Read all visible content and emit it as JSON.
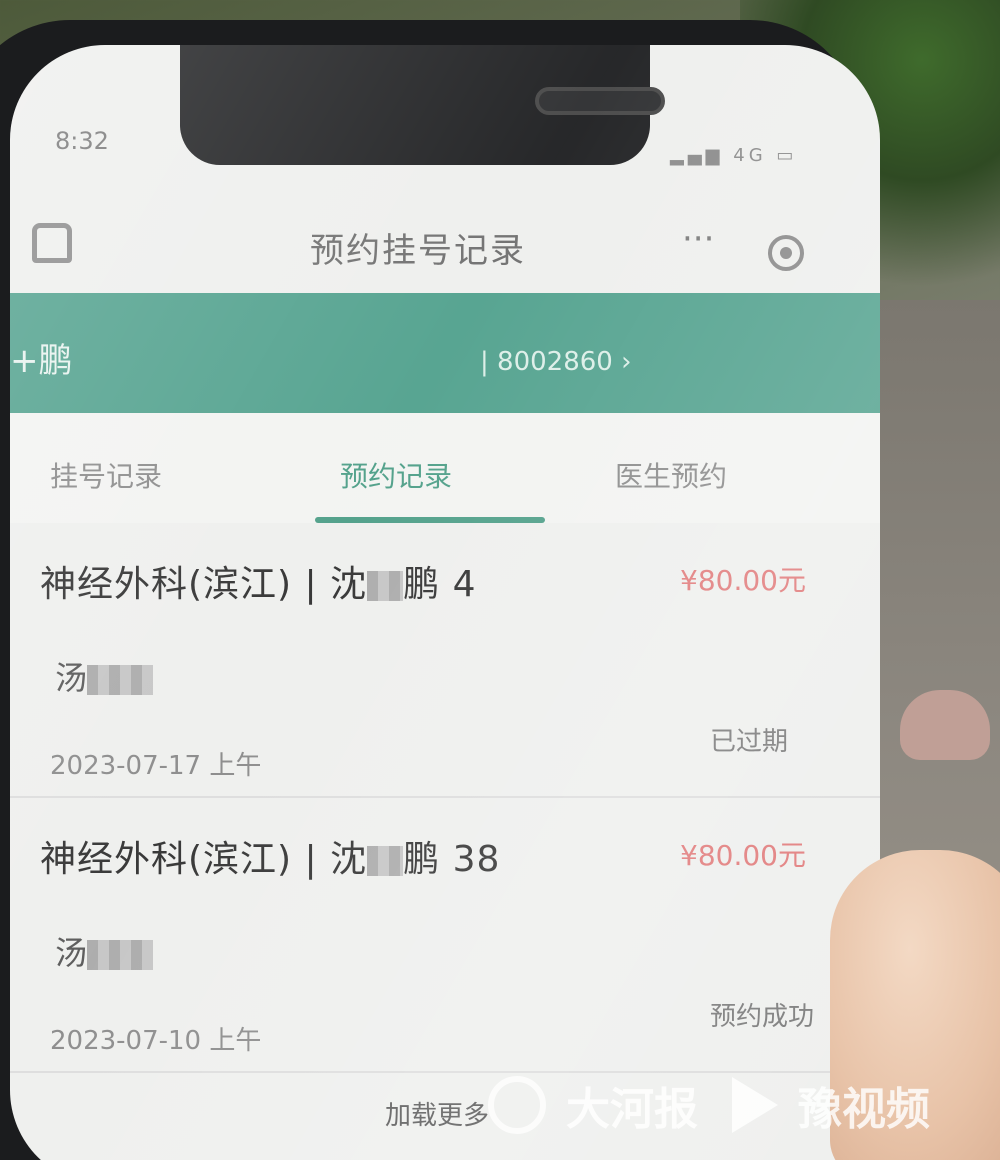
{
  "status_bar": {
    "time": "8:32",
    "network": "4G"
  },
  "nav": {
    "title": "预约挂号记录",
    "more_icon": "ellipsis-icon",
    "close_icon": "target-close-icon",
    "home_icon": "home-icon"
  },
  "patient": {
    "name": "+鹏",
    "card_number": "8002860"
  },
  "tabs": [
    {
      "label": "挂号记录",
      "active": false
    },
    {
      "label": "预约记录",
      "active": true
    },
    {
      "label": "医生预约",
      "active": false
    }
  ],
  "records": [
    {
      "department": "神经外科(滨江)",
      "doctor_prefix": "沈",
      "doctor_suffix": "鹏",
      "number": "4",
      "fee": "¥80.00元",
      "patient_prefix": "汤",
      "date": "2023-07-17 上午",
      "status": "已过期"
    },
    {
      "department": "神经外科(滨江)",
      "doctor_prefix": "沈",
      "doctor_suffix": "鹏",
      "number": "38",
      "fee": "¥80.00元",
      "patient_prefix": "汤",
      "date": "2023-07-10 上午",
      "status": "预约成功"
    }
  ],
  "load_more": "加载更多",
  "watermark": {
    "brand1": "大河报",
    "brand2": "豫视频"
  },
  "colors": {
    "accent": "#4b9d86",
    "fee": "#e07777",
    "patient_bar": "#4fa08c"
  }
}
